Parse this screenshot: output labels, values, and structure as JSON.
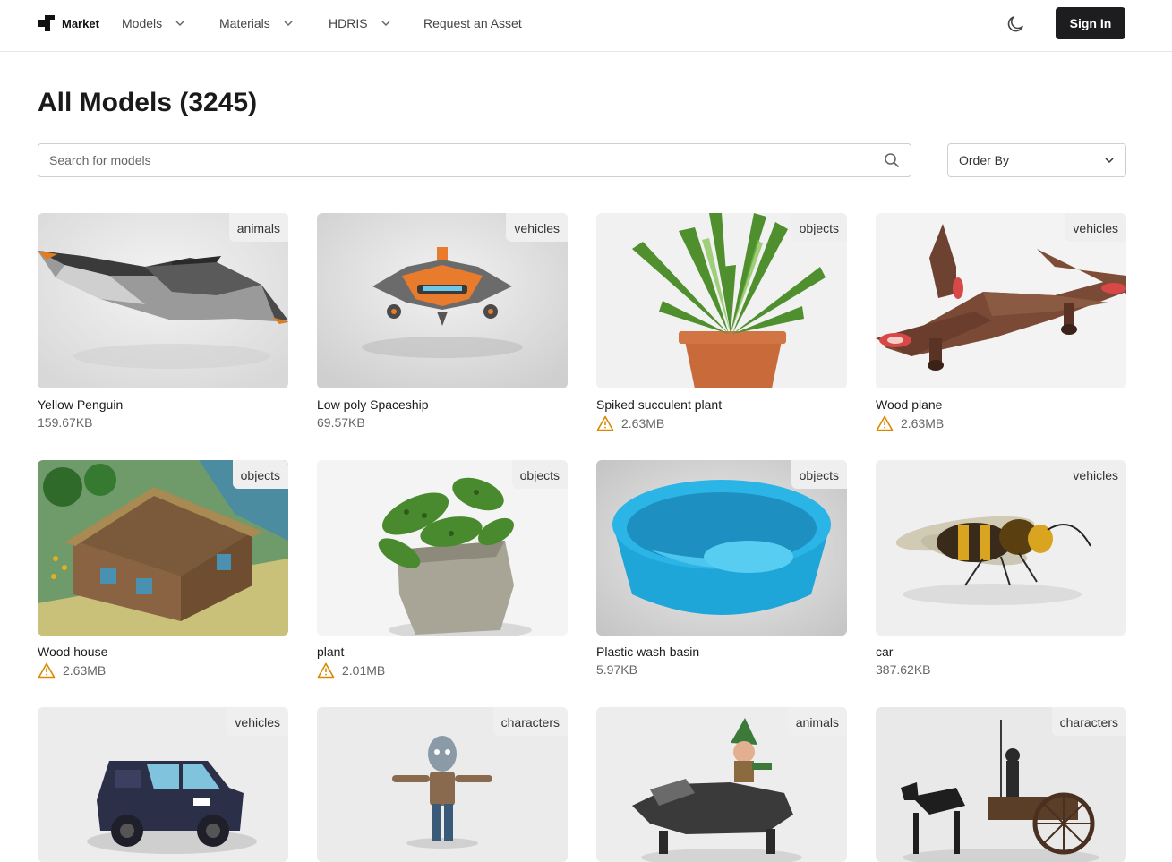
{
  "header": {
    "logo_text": "Market",
    "nav": [
      {
        "label": "Models"
      },
      {
        "label": "Materials"
      },
      {
        "label": "HDRIS"
      },
      {
        "label": "Request an Asset"
      }
    ],
    "theme_icon": "moon-icon",
    "signin_label": "Sign In"
  },
  "main": {
    "title": "All Models (3245)",
    "search_placeholder": "Search for models",
    "order_label": "Order By"
  },
  "models": [
    {
      "name": "Yellow Penguin",
      "size": "159.67KB",
      "category": "animals",
      "warning": false
    },
    {
      "name": "Low poly Spaceship",
      "size": "69.57KB",
      "category": "vehicles",
      "warning": false
    },
    {
      "name": "Spiked succulent plant",
      "size": "2.63MB",
      "category": "objects",
      "warning": true
    },
    {
      "name": "Wood plane",
      "size": "2.63MB",
      "category": "vehicles",
      "warning": true
    },
    {
      "name": "Wood house",
      "size": "2.63MB",
      "category": "objects",
      "warning": true
    },
    {
      "name": "plant",
      "size": "2.01MB",
      "category": "objects",
      "warning": true
    },
    {
      "name": "Plastic wash basin",
      "size": "5.97KB",
      "category": "objects",
      "warning": false
    },
    {
      "name": "car",
      "size": "387.62KB",
      "category": "vehicles",
      "warning": false
    },
    {
      "name": "",
      "size": "",
      "category": "vehicles",
      "warning": false
    },
    {
      "name": "",
      "size": "",
      "category": "characters",
      "warning": false
    },
    {
      "name": "",
      "size": "",
      "category": "animals",
      "warning": false
    },
    {
      "name": "",
      "size": "",
      "category": "characters",
      "warning": false
    }
  ],
  "colors": {
    "accent_dark": "#1d1d1f",
    "warning": "#d98a00",
    "badge_bg": "#efefef"
  }
}
